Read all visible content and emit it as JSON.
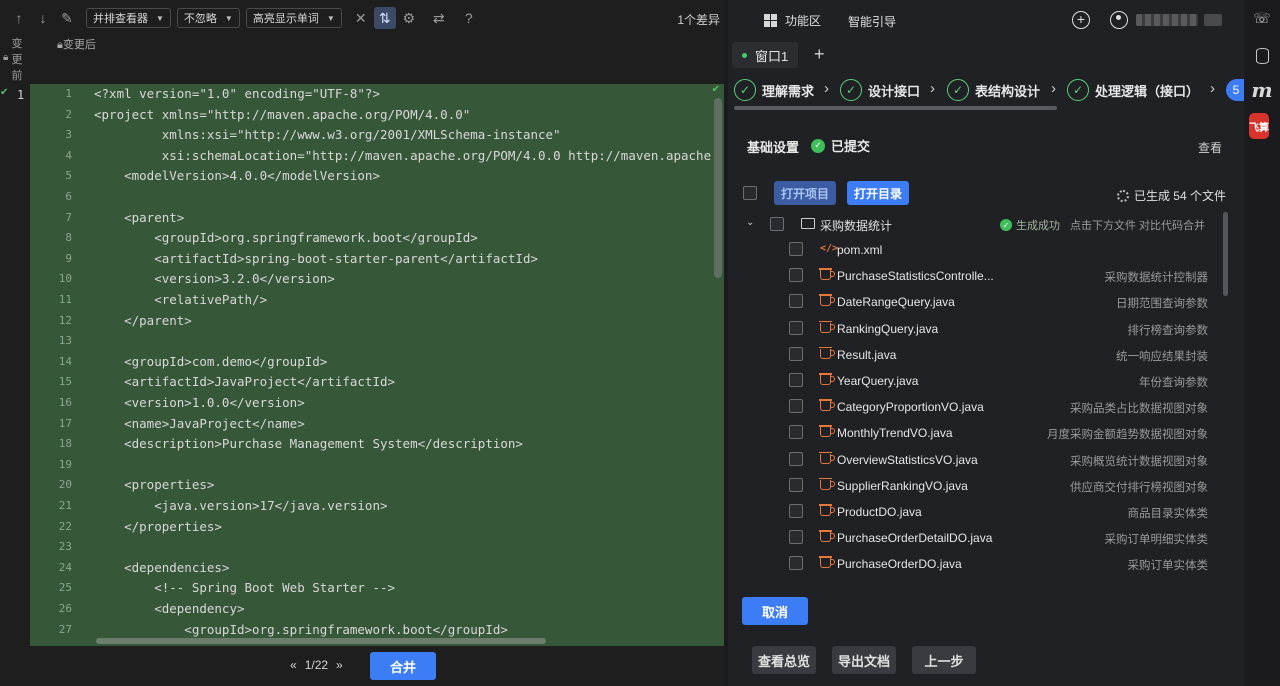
{
  "diff_toolbar": {
    "view_mode": "并排查看器",
    "ignore_mode": "不忽略",
    "highlight_mode": "高亮显示单词",
    "diff_count": "1个差异",
    "before_label": "变更前",
    "after_label": "变更后",
    "gutter_line": "1",
    "page_indicator": "1/22",
    "merge_label": "合并"
  },
  "code_lines": [
    {
      "n": "1",
      "t": "<?xml version=\"1.0\" encoding=\"UTF-8\"?>"
    },
    {
      "n": "2",
      "t": "<project xmlns=\"http://maven.apache.org/POM/4.0.0\""
    },
    {
      "n": "3",
      "t": "         xmlns:xsi=\"http://www.w3.org/2001/XMLSchema-instance\""
    },
    {
      "n": "4",
      "t": "         xsi:schemaLocation=\"http://maven.apache.org/POM/4.0.0 http://maven.apache"
    },
    {
      "n": "5",
      "t": "    <modelVersion>4.0.0</modelVersion>"
    },
    {
      "n": "6",
      "t": ""
    },
    {
      "n": "7",
      "t": "    <parent>"
    },
    {
      "n": "8",
      "t": "        <groupId>org.springframework.boot</groupId>"
    },
    {
      "n": "9",
      "t": "        <artifactId>spring-boot-starter-parent</artifactId>"
    },
    {
      "n": "10",
      "t": "        <version>3.2.0</version>"
    },
    {
      "n": "11",
      "t": "        <relativePath/>"
    },
    {
      "n": "12",
      "t": "    </parent>"
    },
    {
      "n": "13",
      "t": ""
    },
    {
      "n": "14",
      "t": "    <groupId>com.demo</groupId>"
    },
    {
      "n": "15",
      "t": "    <artifactId>JavaProject</artifactId>"
    },
    {
      "n": "16",
      "t": "    <version>1.0.0</version>"
    },
    {
      "n": "17",
      "t": "    <name>JavaProject</name>"
    },
    {
      "n": "18",
      "t": "    <description>Purchase Management System</description>"
    },
    {
      "n": "19",
      "t": ""
    },
    {
      "n": "20",
      "t": "    <properties>"
    },
    {
      "n": "21",
      "t": "        <java.version>17</java.version>"
    },
    {
      "n": "22",
      "t": "    </properties>"
    },
    {
      "n": "23",
      "t": ""
    },
    {
      "n": "24",
      "t": "    <dependencies>"
    },
    {
      "n": "25",
      "t": "        <!-- Spring Boot Web Starter -->"
    },
    {
      "n": "26",
      "t": "        <dependency>"
    },
    {
      "n": "27",
      "t": "            <groupId>org.springframework.boot</groupId>"
    }
  ],
  "right_header": {
    "feature_area": "功能区",
    "smart_guide": "智能引导",
    "window_tab": "窗口1"
  },
  "steps": [
    {
      "label": "理解需求"
    },
    {
      "label": "设计接口"
    },
    {
      "label": "表结构设计"
    },
    {
      "label": "处理逻辑（接口）"
    }
  ],
  "step_number": "5",
  "panel": {
    "title": "基础设置",
    "status": "已提交",
    "view": "查看",
    "open_project": "打开项目",
    "open_dir": "打开目录",
    "generated": "已生成 54 个文件",
    "folder": "采购数据统计",
    "success": "生成成功",
    "success_hint": "点击下方文件 对比代码合并"
  },
  "files": [
    {
      "name": "pom.xml",
      "desc": "",
      "icon": "xml-icon"
    },
    {
      "name": "PurchaseStatisticsControlle...",
      "desc": "采购数据统计控制器",
      "icon": "java-icon"
    },
    {
      "name": "DateRangeQuery.java",
      "desc": "日期范围查询参数",
      "icon": "java-icon"
    },
    {
      "name": "RankingQuery.java",
      "desc": "排行榜查询参数",
      "icon": "java-icon"
    },
    {
      "name": "Result.java",
      "desc": "统一响应结果封装",
      "icon": "java-icon"
    },
    {
      "name": "YearQuery.java",
      "desc": "年份查询参数",
      "icon": "java-icon"
    },
    {
      "name": "CategoryProportionVO.java",
      "desc": "采购品类占比数据视图对象",
      "icon": "java-icon"
    },
    {
      "name": "MonthlyTrendVO.java",
      "desc": "月度采购金额趋势数据视图对象",
      "icon": "java-icon"
    },
    {
      "name": "OverviewStatisticsVO.java",
      "desc": "采购概览统计数据视图对象",
      "icon": "java-icon"
    },
    {
      "name": "SupplierRankingVO.java",
      "desc": "供应商交付排行榜视图对象",
      "icon": "java-icon"
    },
    {
      "name": "ProductDO.java",
      "desc": "商品目录实体类",
      "icon": "java-icon"
    },
    {
      "name": "PurchaseOrderDetailDO.java",
      "desc": "采购订单明细实体类",
      "icon": "java-icon"
    },
    {
      "name": "PurchaseOrderDO.java",
      "desc": "采购订单实体类",
      "icon": "java-icon"
    }
  ],
  "actions": {
    "cancel": "取消",
    "view_overview": "查看总览",
    "export_doc": "导出文档",
    "prev_step": "上一步"
  },
  "strip": {
    "feishu": "飞算"
  },
  "colors": {
    "accent": "#3c7cf5",
    "diff_added_bg": "#375739",
    "success": "#5bd07a",
    "java_icon": "#e5773b"
  }
}
